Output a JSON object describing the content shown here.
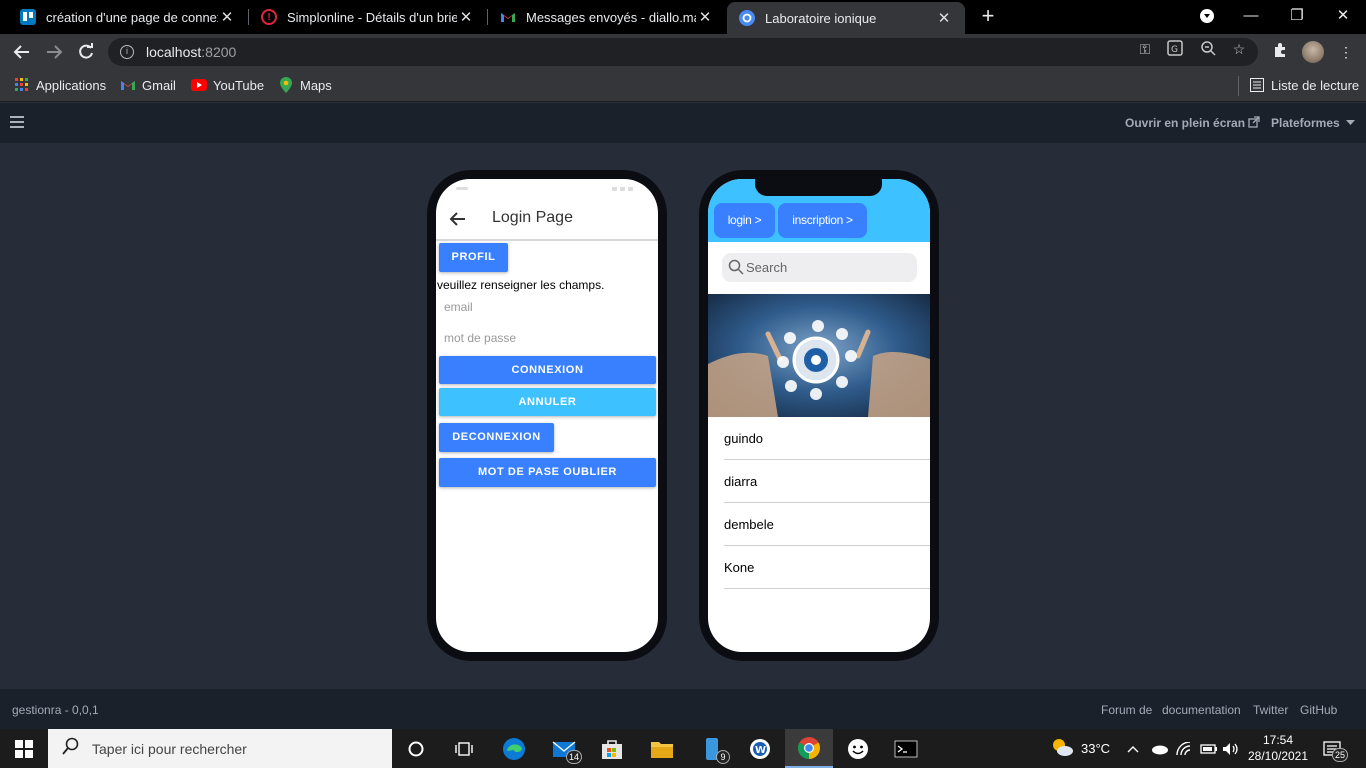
{
  "browser": {
    "tabs": [
      {
        "title": "création d'une page de connexion"
      },
      {
        "title": "Simplonline - Détails d'un brief"
      },
      {
        "title": "Messages envoyés - diallo.mamadou"
      },
      {
        "title": "Laboratoire ionique"
      }
    ],
    "url_host": "localhost",
    "url_port": ":8200",
    "bookmarks": [
      "Applications",
      "Gmail",
      "YouTube",
      "Maps"
    ],
    "reading_list": "Liste de lecture"
  },
  "lab": {
    "fullscreen": "Ouvrir en plein écran",
    "platforms": "Plateformes",
    "version": "gestionra - 0,0,1",
    "footer_links": [
      "Forum de",
      "documentation",
      "Twitter",
      "GitHub"
    ]
  },
  "android": {
    "title": "Login Page",
    "profil_btn": "PROFIL",
    "instructions": "veuillez renseigner les champs.",
    "email_placeholder": "email",
    "password_placeholder": "mot de passe",
    "connexion_btn": "CONNEXION",
    "annuler_btn": "ANNULER",
    "deconnexion_btn": "DECONNEXION",
    "forgot_btn": "MOT DE PASE OUBLIER"
  },
  "ios": {
    "login_btn": "login >",
    "inscription_btn": "inscription >",
    "search_placeholder": "Search",
    "items": [
      "guindo",
      "diarra",
      "dembele",
      "Kone"
    ]
  },
  "taskbar": {
    "search_placeholder": "Taper ici pour rechercher",
    "mail_badge": "14",
    "phone_badge": "9",
    "temperature": "33°C",
    "time": "17:54",
    "date": "28/10/2021",
    "notif_count": "25"
  },
  "colors": {
    "primary": "#3880ff",
    "secondary": "#3dc2ff",
    "lab_bg": "#262c38"
  }
}
